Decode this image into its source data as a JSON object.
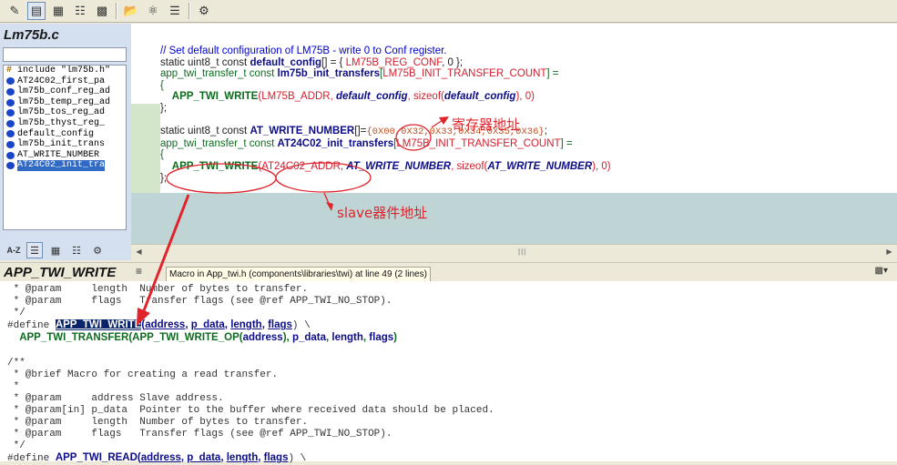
{
  "toolbar": {
    "icons": [
      "edit-icon",
      "window-icon",
      "symbols-icon",
      "book-icon",
      "relation-icon",
      "open-folder-icon",
      "project-icon",
      "list-icon",
      "settings-icon"
    ]
  },
  "symbol_panel": {
    "title": "Lm75b.c",
    "search_value": "",
    "items": [
      {
        "label": "include \"lm75b.h\"",
        "kind": "include",
        "selected": false
      },
      {
        "label": "AT24C02_first_pa",
        "kind": "symbol",
        "selected": false
      },
      {
        "label": "lm75b_conf_reg_ad",
        "kind": "symbol",
        "selected": false
      },
      {
        "label": "lm75b_temp_reg_ad",
        "kind": "symbol",
        "selected": false
      },
      {
        "label": "lm75b_tos_reg_ad",
        "kind": "symbol",
        "selected": false
      },
      {
        "label": "lm75b_thyst_reg_",
        "kind": "symbol",
        "selected": false
      },
      {
        "label": "default_config",
        "kind": "symbol",
        "selected": false
      },
      {
        "label": "lm75b_init_trans",
        "kind": "symbol",
        "selected": false
      },
      {
        "label": "AT_WRITE_NUMBER",
        "kind": "symbol",
        "selected": false
      },
      {
        "label": "AT24C02_init_tra",
        "kind": "symbol",
        "selected": true
      }
    ],
    "bottom_buttons": [
      "A-Z"
    ]
  },
  "editor": {
    "lines": {
      "l1": "// Set default configuration of LM75B - write 0 to Conf register.",
      "l2a": "static uint8_t const ",
      "l2b": "default_config",
      "l2c": "[] = { ",
      "l2d": "LM75B_REG_CONF",
      "l2e": ", 0 };",
      "l3a": "app_twi_transfer_t const ",
      "l3b": "lm75b_init_transfers",
      "l3c": "[",
      "l3d": "LM75B_INIT_TRANSFER_COUNT",
      "l3e": "] =",
      "l4": "{",
      "l5a": "APP_TWI_WRITE",
      "l5b": "(",
      "l5c": "LM75B_ADDR",
      "l5d": ", ",
      "l5e": "default_config",
      "l5f": ", ",
      "l5g": "sizeof",
      "l5h": "(",
      "l5i": "default_config",
      "l5j": "), 0)",
      "l6": "};",
      "l8a": "static uint8_t const ",
      "l8b": "AT_WRITE_NUMBER",
      "l8c": "[]=",
      "l8d": "{0X00,0X32,0X33,0X34,0X35,0X36}",
      "l8e": ";",
      "l9a": "app_twi_transfer_t const ",
      "l9b": "AT24C02_init_transfers",
      "l9c": "[",
      "l9d": "LM75B_INIT_TRANSFER_COUNT",
      "l9e": "] =",
      "l10": "{",
      "l11a": "APP_TWI_WRITE",
      "l11b": "(",
      "l11c": "AT24C02_ADDR",
      "l11d": ", ",
      "l11e": "AT_WRITE_NUMBER",
      "l11f": ", ",
      "l11g": "sizeof",
      "l11h": "(",
      "l11i": "AT_WRITE_NUMBER",
      "l11j": "), 0)",
      "l12": "};"
    }
  },
  "annotations": {
    "register_address": "寄存器地址",
    "slave_address": "slave器件地址",
    "color": "#e0242c"
  },
  "context": {
    "title": "APP_TWI_WRITE",
    "info": "Macro in App_twi.h (components\\libraries\\twi) at line 49 (2 lines)",
    "lines": {
      "c1": " * @param     length  Number of bytes to transfer.",
      "c2": " * @param     flags   Transfer flags (see @ref APP_TWI_NO_STOP).",
      "c3": " */",
      "c4a": "#define ",
      "c4b": "APP_TWI_WRITE",
      "c4c": "(",
      "c4d": "address",
      "c4e": ", ",
      "c4f": "p_data",
      "c4g": ", ",
      "c4h": "length",
      "c4i": ", ",
      "c4j": "flags",
      "c4k": ") \\",
      "c5a": "  ",
      "c5b": "APP_TWI_TRANSFER",
      "c5c": "(",
      "c5d": "APP_TWI_WRITE_OP",
      "c5e": "(",
      "c5f": "address",
      "c5g": "), ",
      "c5h": "p_data",
      "c5i": ", ",
      "c5j": "length",
      "c5k": ", ",
      "c5l": "flags",
      "c5m": ")",
      "c6": "",
      "c7": "/**",
      "c8": " * @brief Macro for creating a read transfer.",
      "c9": " *",
      "c10": " * @param     address Slave address.",
      "c11": " * @param[in] p_data  Pointer to the buffer where received data should be placed.",
      "c12": " * @param     length  Number of bytes to transfer.",
      "c13": " * @param     flags   Transfer flags (see @ref APP_TWI_NO_STOP).",
      "c14": " */",
      "c15a": "#define ",
      "c15b": "APP_TWI_READ",
      "c15c": "(",
      "c15d": "address",
      "c15e": ", ",
      "c15f": "p_data",
      "c15g": ", ",
      "c15h": "length",
      "c15i": ", ",
      "c15j": "flags",
      "c15k": ") \\"
    }
  }
}
